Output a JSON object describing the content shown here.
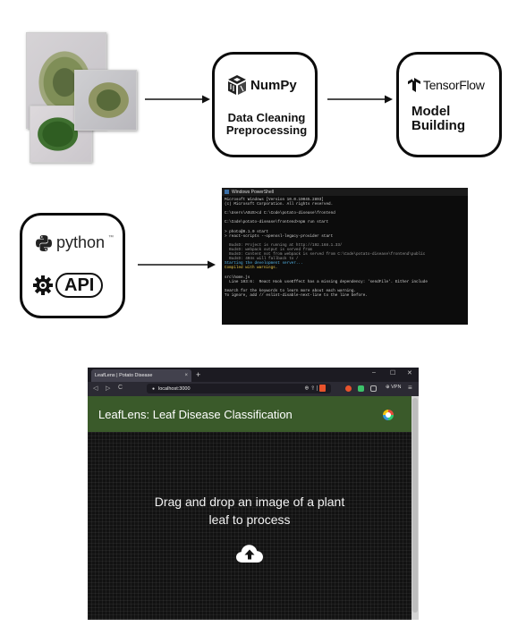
{
  "numpy": {
    "logo_text": "NumPy",
    "caption": "Data Cleaning Preprocessing"
  },
  "tensorflow": {
    "logo_text": "TensorFlow",
    "caption": "Model Building"
  },
  "api_box": {
    "python_text": "python",
    "python_tm": "™",
    "api_text": "API"
  },
  "terminal": {
    "title": "Windows PowerShell",
    "lines": [
      {
        "text": "Microsoft Windows [Version 10.0.19045.2893]",
        "color": "default"
      },
      {
        "text": "(c) Microsoft Corporation. All rights reserved.",
        "color": "default"
      },
      {
        "text": "",
        "color": "default"
      },
      {
        "text": "C:\\Users\\ASUS>cd C:\\Code\\potato-disease\\frontend",
        "color": "default"
      },
      {
        "text": "",
        "color": "default"
      },
      {
        "text": "C:\\Code\\potato-disease\\frontend>npm run start",
        "color": "default"
      },
      {
        "text": "",
        "color": "default"
      },
      {
        "text": "> photo@0.1.0 start",
        "color": "default"
      },
      {
        "text": "> react-scripts --openssl-legacy-provider start",
        "color": "default"
      },
      {
        "text": "",
        "color": "default"
      },
      {
        "text": "  BudsD: Project is running at http://192.168.1.33/",
        "color": "gray"
      },
      {
        "text": "  BudsD: webpack output is served from",
        "color": "gray"
      },
      {
        "text": "  BudsD: Content not from webpack is served from C:\\Code\\potato-disease\\frontend\\public",
        "color": "gray"
      },
      {
        "text": "  BudsD: 404s will fallback to /",
        "color": "gray"
      },
      {
        "text": "Starting the development server...",
        "color": "cyan"
      },
      {
        "text": "Compiled with warnings.",
        "color": "yellow"
      },
      {
        "text": "",
        "color": "default"
      },
      {
        "text": "src\\home.js",
        "color": "default"
      },
      {
        "text": "  Line 103:6:  React Hook useEffect has a missing dependency: 'sendFile'. Either include",
        "color": "default"
      },
      {
        "text": "",
        "color": "default"
      },
      {
        "text": "Search for the keywords to learn more about each warning.",
        "color": "default"
      },
      {
        "text": "To ignore, add // eslint-disable-next-line to the line before.",
        "color": "default"
      }
    ]
  },
  "browser": {
    "tab_title": "LeafLens | Potato Disease",
    "tab_close": "×",
    "new_tab": "+",
    "minimize": "–",
    "maximize": "☐",
    "close": "✕",
    "back": "◁",
    "forward": "▷",
    "reload": "C",
    "url": "localhost:3000",
    "url_tools": "⊕ ⇪ |",
    "vpn": "⊕ VPN",
    "menu": "≡",
    "app_title": "LeafLens: Leaf Disease Classification",
    "drop_text": "Drag and drop an image of a plant leaf to process"
  }
}
